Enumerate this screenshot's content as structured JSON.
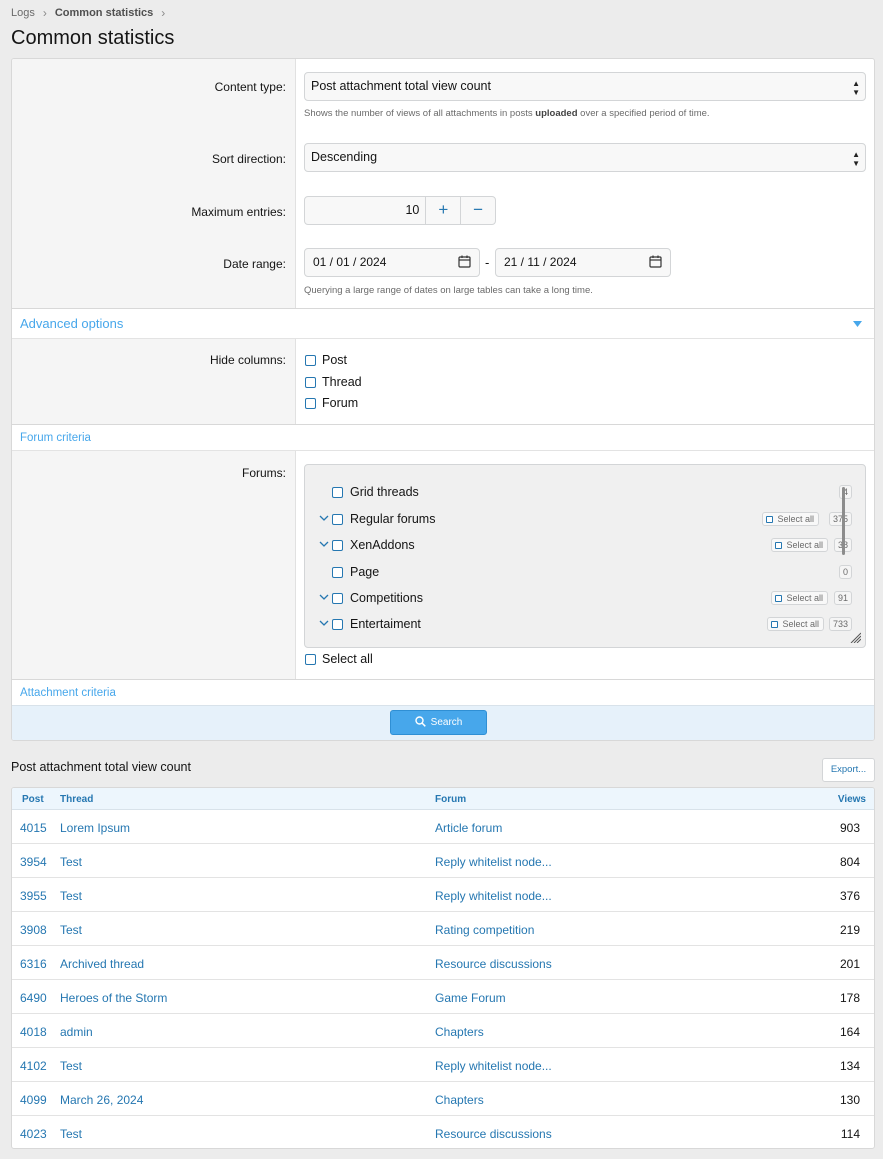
{
  "breadcrumb": [
    "Logs",
    "Common statistics"
  ],
  "page_title": "Common statistics",
  "form": {
    "content_type": {
      "label": "Content type:",
      "value": "Post attachment total view count",
      "hint_before": "Shows the number of views of all attachments in posts ",
      "hint_bold": "uploaded",
      "hint_after": " over a specified period of time."
    },
    "sort_direction": {
      "label": "Sort direction:",
      "value": "Descending"
    },
    "max_entries": {
      "label": "Maximum entries:",
      "value": "10",
      "plus": "+",
      "minus": "−"
    },
    "date_range": {
      "label": "Date range:",
      "from": "01 / 01 / 2024",
      "to": "21 / 11 / 2024",
      "separator": "-",
      "hint": "Querying a large range of dates on large tables can take a long time."
    },
    "advanced_options": "Advanced options",
    "hide_columns": {
      "label": "Hide columns:",
      "options": [
        "Post",
        "Thread",
        "Forum"
      ]
    },
    "forum_criteria": "Forum criteria",
    "forums": {
      "label": "Forums:",
      "items": [
        {
          "name": "Grid threads",
          "count": "4",
          "expandable": false,
          "select_all": ""
        },
        {
          "name": "Regular forums",
          "count": "375",
          "expandable": true,
          "select_all": "Select all"
        },
        {
          "name": "XenAddons",
          "count": "38",
          "expandable": true,
          "select_all": "Select all"
        },
        {
          "name": "Page",
          "count": "0",
          "expandable": false,
          "select_all": ""
        },
        {
          "name": "Competitions",
          "count": "91",
          "expandable": true,
          "select_all": "Select all"
        },
        {
          "name": "Entertaiment",
          "count": "733",
          "expandable": true,
          "select_all": "Select all"
        }
      ],
      "select_all_label": "Select all"
    },
    "attachment_criteria": "Attachment criteria",
    "search_button": "Search"
  },
  "results": {
    "title": "Post attachment total view count",
    "export_button": "Export...",
    "columns": [
      "Post",
      "Thread",
      "Forum",
      "Views"
    ],
    "rows": [
      {
        "post": "4015",
        "thread": "Lorem Ipsum",
        "forum": "Article forum",
        "views": "903"
      },
      {
        "post": "3954",
        "thread": "Test",
        "forum": "Reply whitelist node...",
        "views": "804"
      },
      {
        "post": "3955",
        "thread": "Test",
        "forum": "Reply whitelist node...",
        "views": "376"
      },
      {
        "post": "3908",
        "thread": "Test",
        "forum": "Rating competition",
        "views": "219"
      },
      {
        "post": "6316",
        "thread": "Archived thread",
        "forum": "Resource discussions",
        "views": "201"
      },
      {
        "post": "6490",
        "thread": "Heroes of the Storm",
        "forum": "Game Forum",
        "views": "178"
      },
      {
        "post": "4018",
        "thread": "admin",
        "forum": "Chapters",
        "views": "164"
      },
      {
        "post": "4102",
        "thread": "Test",
        "forum": "Reply whitelist node...",
        "views": "134"
      },
      {
        "post": "4099",
        "thread": "March 26, 2024",
        "forum": "Chapters",
        "views": "130"
      },
      {
        "post": "4023",
        "thread": "Test",
        "forum": "Resource discussions",
        "views": "114"
      }
    ]
  },
  "colors": {
    "link": "#2577b1",
    "accent": "#47a7eb",
    "label_bg": "#f5f5f5"
  }
}
